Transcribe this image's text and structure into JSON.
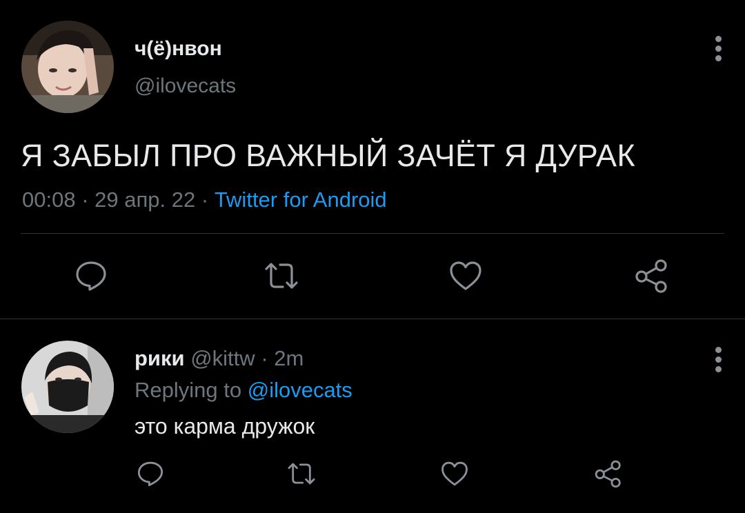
{
  "tweet": {
    "author": {
      "display_name": "ч(ё)нвон",
      "handle": "@ilovecats",
      "avatar": "avatar-photo"
    },
    "text": "Я ЗАБЫЛ ПРО ВАЖНЫЙ ЗАЧЁТ Я ДУРАК",
    "time": "00:08",
    "date": "29 апр. 22",
    "separator": "·",
    "source": "Twitter for Android",
    "actions": {
      "reply_icon": "reply-icon",
      "retweet_icon": "retweet-icon",
      "like_icon": "like-icon",
      "share_icon": "share-icon"
    }
  },
  "reply": {
    "author": {
      "display_name": "рики",
      "handle": "@kittw",
      "avatar": "avatar-photo"
    },
    "separator": "·",
    "time_ago": "2m",
    "replying_prefix": "Replying to",
    "replying_to": "@ilovecats",
    "text": "это карма дружок",
    "actions": {
      "reply_icon": "reply-icon",
      "retweet_icon": "retweet-icon",
      "like_icon": "like-icon",
      "share_icon": "share-icon"
    }
  },
  "colors": {
    "background": "#000000",
    "text_primary": "#e7e9ea",
    "text_secondary": "#6e767d",
    "accent": "#1d9bf0",
    "divider": "#2f3336",
    "icon": "#8b9197"
  }
}
